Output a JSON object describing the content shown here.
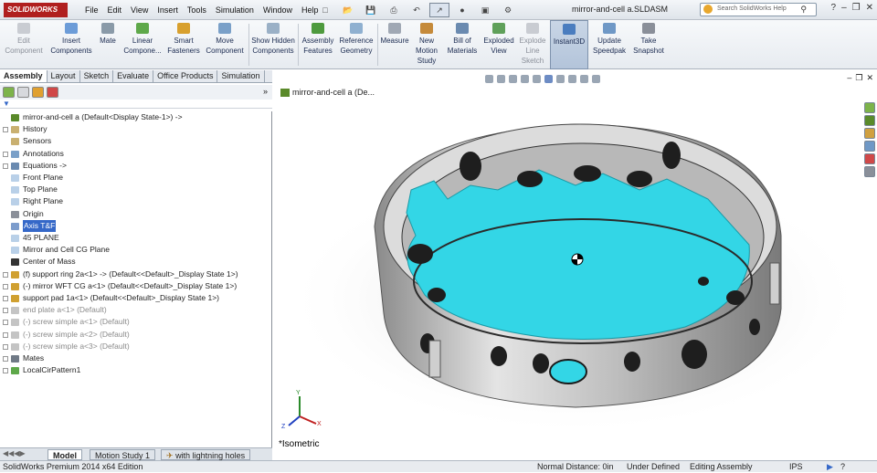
{
  "app": {
    "logo_text": "SOLIDWORKS",
    "doc_title": "mirror-and-cell a.SLDASM"
  },
  "menu": [
    "File",
    "Edit",
    "View",
    "Insert",
    "Tools",
    "Simulation",
    "Window",
    "Help"
  ],
  "search": {
    "placeholder": "Search SolidWorks Help"
  },
  "commands": [
    {
      "label": "Edit Component",
      "dim": true
    },
    {
      "label": "Insert Components"
    },
    {
      "label": "Mate"
    },
    {
      "label": "Linear Compone..."
    },
    {
      "label": "Smart Fasteners"
    },
    {
      "label": "Move Component"
    },
    {
      "label": "Show Hidden Components"
    },
    {
      "label": "Assembly Features"
    },
    {
      "label": "Reference Geometry"
    },
    {
      "label": "Measure"
    },
    {
      "label": "New Motion Study"
    },
    {
      "label": "Bill of Materials"
    },
    {
      "label": "Exploded View"
    },
    {
      "label": "Explode Line Sketch",
      "dim": true
    },
    {
      "label": "Instant3D",
      "selected": true
    },
    {
      "label": "Update Speedpak"
    },
    {
      "label": "Take Snapshot"
    }
  ],
  "tabs": [
    "Assembly",
    "Layout",
    "Sketch",
    "Evaluate",
    "Office Products",
    "Simulation"
  ],
  "tree": [
    {
      "label": "mirror-and-cell a  (Default<Display State-1>) ->",
      "icon": "assembly",
      "exp": false
    },
    {
      "label": "History",
      "icon": "folder",
      "exp": true
    },
    {
      "label": "Sensors",
      "icon": "folder",
      "exp": false
    },
    {
      "label": "Annotations",
      "icon": "annotation",
      "exp": true
    },
    {
      "label": "Equations ->",
      "icon": "equation",
      "exp": true
    },
    {
      "label": "Front Plane",
      "icon": "plane",
      "exp": false
    },
    {
      "label": "Top Plane",
      "icon": "plane",
      "exp": false
    },
    {
      "label": "Right Plane",
      "icon": "plane",
      "exp": false
    },
    {
      "label": "Origin",
      "icon": "origin",
      "exp": false
    },
    {
      "label": "Axis T&F",
      "icon": "axis",
      "exp": false,
      "highlight": true
    },
    {
      "label": "45 PLANE",
      "icon": "plane",
      "exp": false
    },
    {
      "label": "Mirror and Cell CG Plane",
      "icon": "plane",
      "exp": false
    },
    {
      "label": "Center of Mass",
      "icon": "com",
      "exp": false
    },
    {
      "label": "(f) support ring 2a<1> -> (Default<<Default>_Display State 1>)",
      "icon": "part",
      "exp": true
    },
    {
      "label": "(-) mirror WFT CG a<1> (Default<<Default>_Display State 1>)",
      "icon": "part",
      "exp": true
    },
    {
      "label": "support pad 1a<1> (Default<<Default>_Display State 1>)",
      "icon": "part",
      "exp": true
    },
    {
      "label": "end plate a<1> (Default)",
      "icon": "part-gray",
      "exp": true,
      "gray": true
    },
    {
      "label": "(-) screw simple a<1> (Default)",
      "icon": "part-gray",
      "exp": true,
      "gray": true
    },
    {
      "label": "(-) screw simple a<2> (Default)",
      "icon": "part-gray",
      "exp": true,
      "gray": true
    },
    {
      "label": "(-) screw simple a<3> (Default)",
      "icon": "part-gray",
      "exp": true,
      "gray": true
    },
    {
      "label": "Mates",
      "icon": "mates",
      "exp": true
    },
    {
      "label": "LocalCirPattern1",
      "icon": "pattern",
      "exp": true
    }
  ],
  "viewport": {
    "head_label": "mirror-and-cell a  (De...",
    "view_name": "*Isometric"
  },
  "bottom_tabs": [
    "Model",
    "Motion Study 1",
    "with lightning holes"
  ],
  "status": {
    "edition": "SolidWorks Premium 2014 x64 Edition",
    "distance": "Normal Distance: 0in",
    "defined": "Under Defined",
    "mode": "Editing Assembly",
    "units": "IPS"
  },
  "colors": {
    "mirror": "#33d6e6",
    "ring": "#d4d4d4",
    "accent": "#3568c8"
  }
}
